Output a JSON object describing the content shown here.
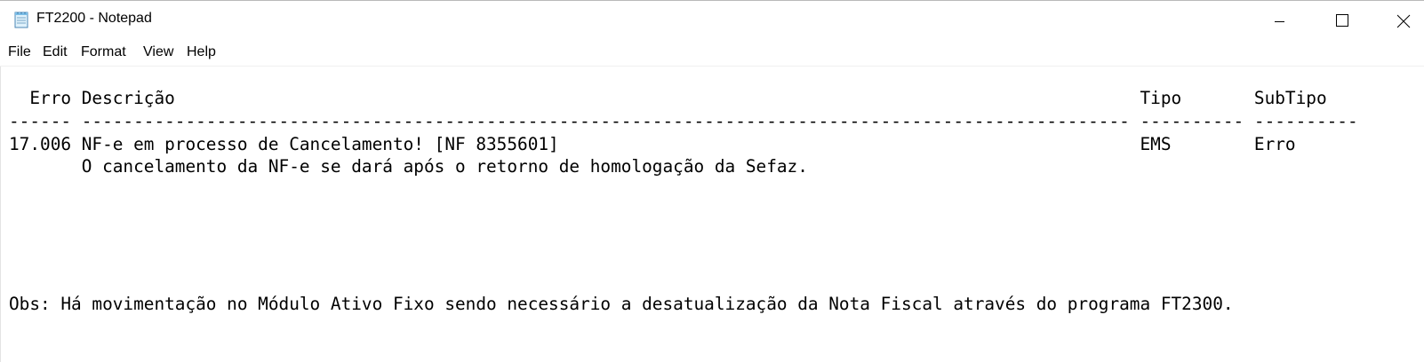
{
  "window": {
    "title": "FT2200 - Notepad",
    "app_icon": "notepad-icon"
  },
  "caption_buttons": {
    "minimize_icon": "minimize-icon",
    "maximize_icon": "maximize-icon",
    "close_icon": "close-icon"
  },
  "menu": {
    "items": [
      {
        "label": "File"
      },
      {
        "label": "Edit"
      },
      {
        "label": "Format"
      },
      {
        "label": "View"
      },
      {
        "label": "Help"
      }
    ]
  },
  "document": {
    "lines": [
      "  Erro Descrição                                                                                             Tipo       SubTipo",
      "------ ----------------------------------------------------------------------------------------------------- ---------- ----------",
      "17.006 NF-e em processo de Cancelamento! [NF 8355601]                                                        EMS        Erro",
      "       O cancelamento da NF-e se dará após o retorno de homologação da Sefaz.",
      "",
      "",
      "",
      "",
      "",
      "Obs: Há movimentação no Módulo Ativo Fixo sendo necessário a desatualização da Nota Fiscal através do programa FT2300."
    ]
  },
  "colors": {
    "background": "#ffffff",
    "text": "#000000",
    "icon_stroke": "#000000"
  }
}
